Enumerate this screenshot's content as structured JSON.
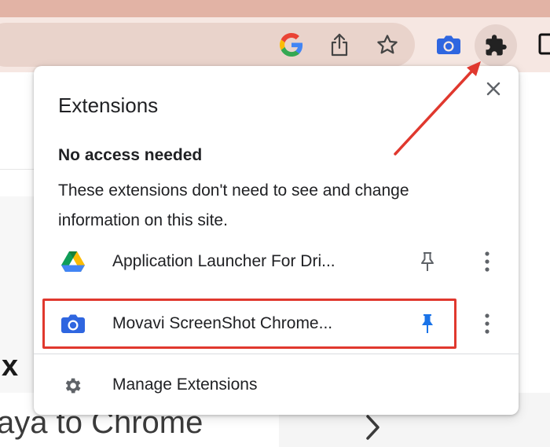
{
  "toolbar": {
    "icons": [
      "google-g-icon",
      "share-icon",
      "star-icon",
      "camera-icon",
      "puzzle-icon",
      "window-icon"
    ],
    "accent_color": "#1a73e8"
  },
  "page": {
    "big_letter": "x",
    "text_line": "aya to Chrome"
  },
  "popup": {
    "title": "Extensions",
    "section_heading": "No access needed",
    "section_description": "These extensions don't need to see and change information on this site.",
    "extensions": [
      {
        "name": "Application Launcher For Dri...",
        "icon": "google-drive-icon",
        "pinned": false
      },
      {
        "name": "Movavi ScreenShot Chrome...",
        "icon": "camera-icon",
        "pinned": true
      }
    ],
    "manage_label": "Manage Extensions"
  },
  "annotation": {
    "highlight_color": "#e0382e"
  }
}
